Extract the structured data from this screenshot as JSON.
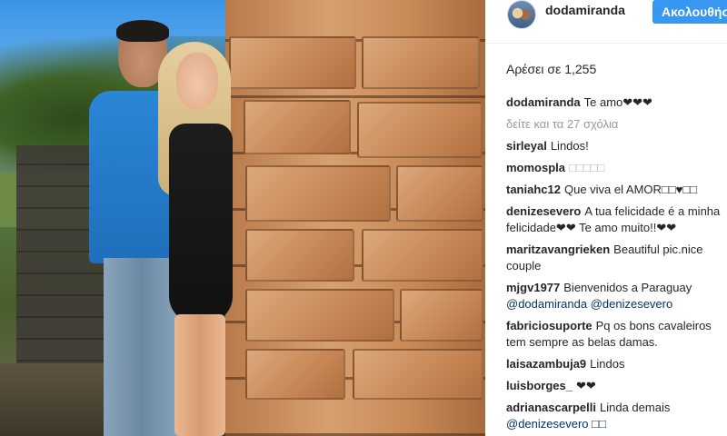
{
  "post": {
    "photo_alt": "couple-photo",
    "author": "dodamiranda",
    "follow_label": "Ακολουθήστε",
    "likes_text": "Αρέσει σε 1,255",
    "caption": {
      "user": "dodamiranda",
      "text": "Te amo❤❤❤"
    },
    "view_all_comments": "δείτε και τα 27 σχόλια"
  },
  "comments": [
    {
      "user": "sirleyal",
      "text": "Lindos!"
    },
    {
      "user": "momospla",
      "text": "□□□□□"
    },
    {
      "user": "taniahc12",
      "text": "Que viva el AMOR□□♥□□"
    },
    {
      "user": "denizesevero",
      "text": "A tua felicidade é a minha felicidade❤❤ Te amo muito!!❤❤"
    },
    {
      "user": "maritzavangrieken",
      "text": "Beautiful pic.nice couple"
    },
    {
      "user": "mjgv1977",
      "text": "Bienvenidos a Paraguay",
      "mentions": "@dodamiranda @denizesevero"
    },
    {
      "user": "fabriciosuporte",
      "text": "Pq os bons cavaleiros tem sempre as belas damas."
    },
    {
      "user": "laisazambuja9",
      "text": "Lindos"
    },
    {
      "user": "luisborges_",
      "text": "❤❤"
    },
    {
      "user": "adrianascarpelli",
      "text": "Linda demais",
      "mentions": "@denizesevero □□"
    }
  ],
  "colors": {
    "follow_button": "#3897f0",
    "mention": "#003569",
    "muted": "#999999"
  }
}
